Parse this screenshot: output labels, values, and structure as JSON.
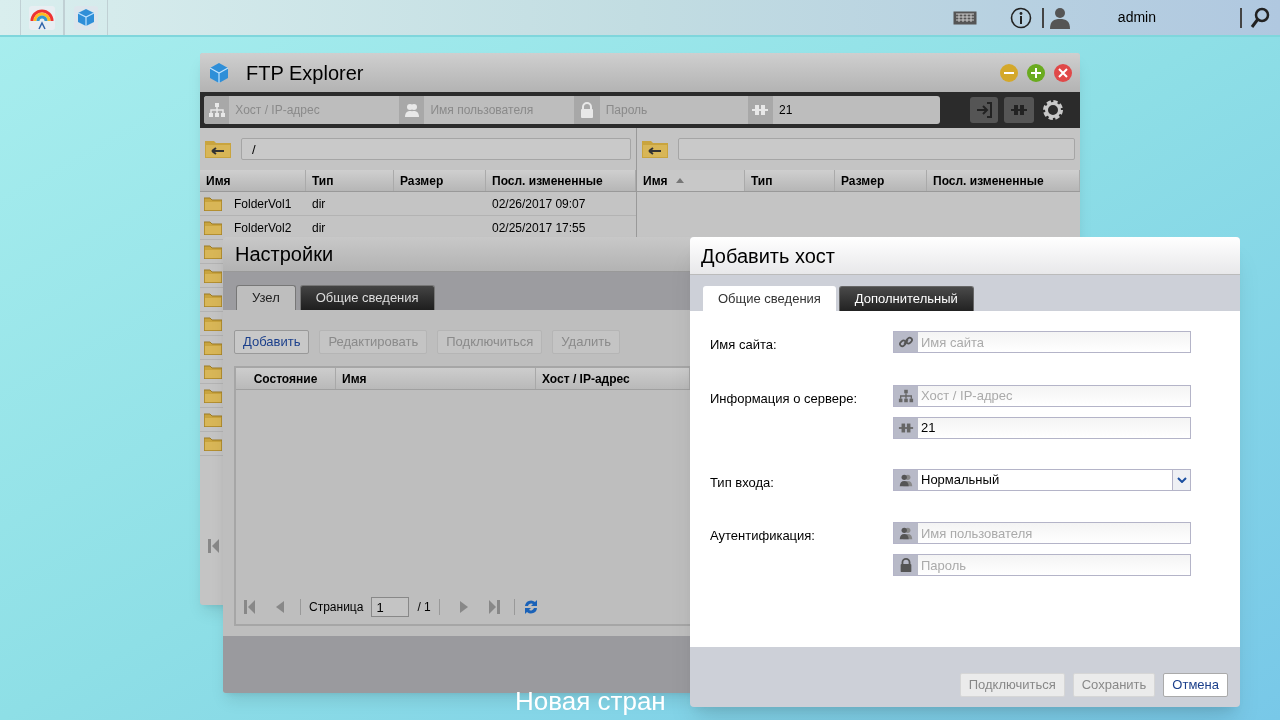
{
  "topbar": {
    "apps": [
      {
        "kind": "rainbow"
      },
      {
        "kind": "cube"
      }
    ],
    "user": "admin"
  },
  "ftp_window": {
    "title": "FTP Explorer",
    "connection": {
      "host_placeholder": "Хост / IP-адрес",
      "user_placeholder": "Имя пользователя",
      "password_placeholder": "Пароль",
      "port": "21"
    },
    "local": {
      "path": "/",
      "columns": [
        "Имя",
        "Тип",
        "Размер",
        "Посл. измененные"
      ],
      "rows": [
        {
          "kind": "folder",
          "name": "FolderVol1",
          "type": "dir",
          "modified": "02/26/2017 09:07"
        },
        {
          "kind": "folder",
          "name": "FolderVol2",
          "type": "dir",
          "modified": "02/25/2017 17:55"
        },
        {
          "kind": "folder"
        },
        {
          "kind": "folder"
        },
        {
          "kind": "folder"
        },
        {
          "kind": "folder"
        },
        {
          "kind": "folder"
        },
        {
          "kind": "folder"
        },
        {
          "kind": "folder"
        },
        {
          "kind": "folder"
        },
        {
          "kind": "folder"
        }
      ]
    },
    "remote": {
      "columns": [
        {
          "label": "Имя",
          "sorted": true
        },
        {
          "label": "Тип",
          "sorted": false
        },
        {
          "label": "Размер",
          "sorted": false
        },
        {
          "label": "Посл. измененные",
          "sorted": false
        }
      ]
    }
  },
  "settings_window": {
    "title": "Настройки",
    "tabs": [
      {
        "label": "Узел",
        "selected": true
      },
      {
        "label": "Общие сведения",
        "selected": false
      }
    ],
    "buttons": [
      {
        "label": "Добавить",
        "disabled": false
      },
      {
        "label": "Редактировать",
        "disabled": true
      },
      {
        "label": "Подключиться",
        "disabled": true
      },
      {
        "label": "Удалить",
        "disabled": true
      }
    ],
    "columns": [
      "Состояние",
      "Имя",
      "Хост / IP-адрес"
    ],
    "pager": {
      "label": "Страница",
      "page": "1",
      "total": "/ 1"
    }
  },
  "dialog": {
    "title": "Добавить хост",
    "tabs": [
      {
        "label": "Общие сведения",
        "selected": true
      },
      {
        "label": "Дополнительный",
        "selected": false
      }
    ],
    "fields": [
      {
        "label": "Имя сайта:",
        "inputs": [
          {
            "kind": "site",
            "placeholder": "Имя сайта"
          }
        ]
      },
      {
        "label": "Информация о сервере:",
        "inputs": [
          {
            "kind": "host",
            "placeholder": "Хост / IP-адрес"
          },
          {
            "kind": "port",
            "value": "21"
          }
        ]
      },
      {
        "label": "Тип входа:",
        "inputs": [
          {
            "kind": "login",
            "value": "Нормальный"
          }
        ]
      },
      {
        "label": "Аутентификация:",
        "inputs": [
          {
            "kind": "username",
            "placeholder": "Имя пользователя"
          },
          {
            "kind": "password",
            "placeholder": "Пароль"
          }
        ]
      }
    ],
    "buttons": [
      {
        "label": "Подключиться",
        "disabled": true
      },
      {
        "label": "Сохранить",
        "disabled": true
      },
      {
        "label": "Отмена",
        "disabled": false
      }
    ]
  },
  "desktop_label": "Новая стран"
}
